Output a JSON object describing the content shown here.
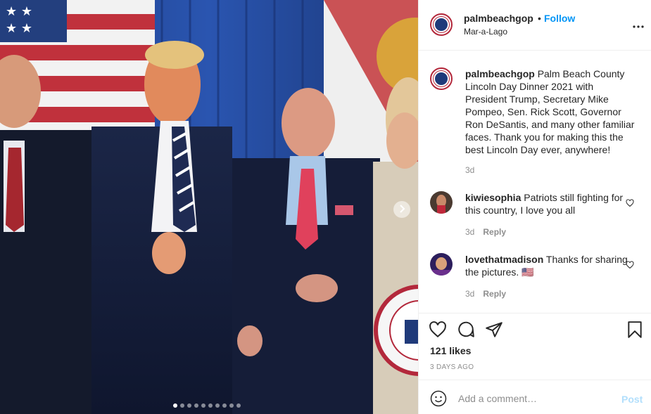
{
  "header": {
    "username": "palmbeachgop",
    "separator": "•",
    "follow_label": "Follow",
    "location": "Mar-a-Lago"
  },
  "caption": {
    "username": "palmbeachgop",
    "text": "Palm Beach County Lincoln Day Dinner 2021 with President Trump, Secretary Mike Pompeo, Sen. Rick Scott, Governor Ron DeSantis, and many other familiar faces. Thank you for making this the best Lincoln Day ever, anywhere!",
    "time": "3d"
  },
  "comments": [
    {
      "username": "kiwiesophia",
      "text": "Patriots still fighting for this country, I love you all",
      "time": "3d",
      "reply_label": "Reply"
    },
    {
      "username": "lovethatmadison",
      "text": "Thanks for sharing the pictures. 🇺🇸",
      "time": "3d",
      "reply_label": "Reply"
    }
  ],
  "stats": {
    "likes": "121 likes",
    "posted": "3 DAYS AGO"
  },
  "composer": {
    "placeholder": "Add a comment…",
    "post_label": "Post"
  },
  "carousel": {
    "total_slides": 10,
    "current_slide": 1
  },
  "colors": {
    "link_blue": "#0095f6",
    "post_disabled": "#b2dffc",
    "muted": "#8e8e8e"
  },
  "icons": [
    "heart-icon",
    "comment-icon",
    "share-icon",
    "bookmark-icon",
    "emoji-icon",
    "more-icon",
    "chevron-right-icon"
  ]
}
